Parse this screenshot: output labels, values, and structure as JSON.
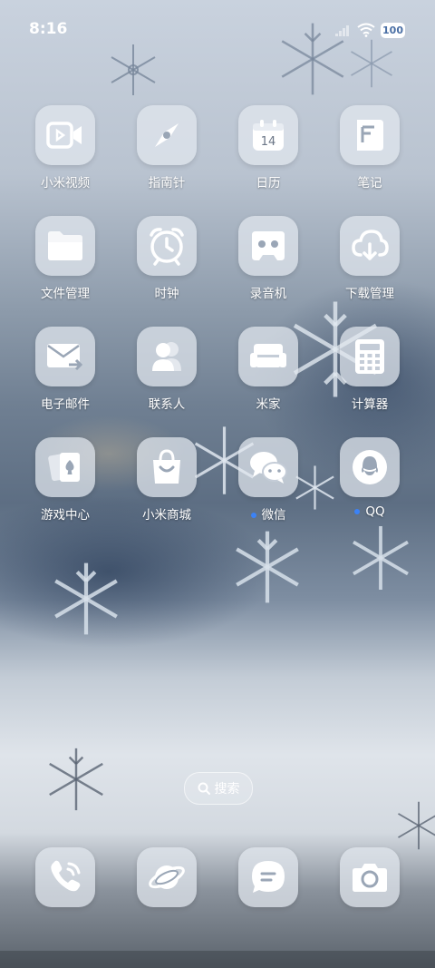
{
  "status_bar": {
    "time": "8:16",
    "battery": "100"
  },
  "apps": [
    {
      "label": "小米视频",
      "icon": "video-icon"
    },
    {
      "label": "指南针",
      "icon": "compass-icon"
    },
    {
      "label": "日历",
      "icon": "calendar-icon",
      "date": "14"
    },
    {
      "label": "笔记",
      "icon": "notes-icon"
    },
    {
      "label": "文件管理",
      "icon": "folder-icon"
    },
    {
      "label": "时钟",
      "icon": "clock-icon"
    },
    {
      "label": "录音机",
      "icon": "recorder-icon"
    },
    {
      "label": "下载管理",
      "icon": "download-icon"
    },
    {
      "label": "电子邮件",
      "icon": "mail-icon"
    },
    {
      "label": "联系人",
      "icon": "contacts-icon"
    },
    {
      "label": "米家",
      "icon": "sofa-icon"
    },
    {
      "label": "计算器",
      "icon": "calculator-icon"
    },
    {
      "label": "游戏中心",
      "icon": "cards-icon"
    },
    {
      "label": "小米商城",
      "icon": "shopping-bag-icon"
    },
    {
      "label": "微信",
      "icon": "wechat-icon",
      "new_dot": true
    },
    {
      "label": "QQ",
      "icon": "qq-icon",
      "new_dot": true
    }
  ],
  "search": {
    "label": "搜索",
    "icon": "search-icon"
  },
  "dock": [
    {
      "icon": "phone-icon"
    },
    {
      "icon": "browser-planet-icon"
    },
    {
      "icon": "messages-icon"
    },
    {
      "icon": "camera-icon"
    }
  ],
  "colors": {
    "icon_glyph": "#ffffff",
    "icon_bg": "#e2e7ee",
    "notification_dot": "#3b82f6"
  }
}
